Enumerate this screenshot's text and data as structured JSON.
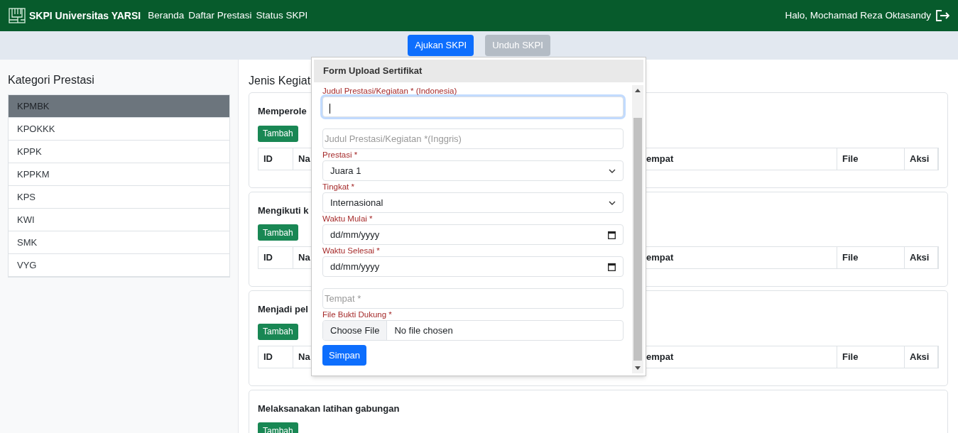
{
  "navbar": {
    "brand": "SKPI Universitas YARSI",
    "links": [
      "Beranda",
      "Daftar Prestasi",
      "Status SKPI"
    ],
    "greeting": "Halo, Mochamad Reza Oktasandy"
  },
  "actions": [
    {
      "label": "Ajukan SKPI",
      "disabled": false
    },
    {
      "label": "Unduh SKPI",
      "disabled": true
    }
  ],
  "sidebar": {
    "title": "Kategori Prestasi",
    "items": [
      {
        "label": "KPMBK",
        "selected": true
      },
      {
        "label": "KPOKKK",
        "selected": false
      },
      {
        "label": "KPPK",
        "selected": false
      },
      {
        "label": "KPPKM",
        "selected": false
      },
      {
        "label": "KPS",
        "selected": false
      },
      {
        "label": "KWI",
        "selected": false
      },
      {
        "label": "SMK",
        "selected": false
      },
      {
        "label": "VYG",
        "selected": false
      }
    ]
  },
  "main": {
    "title": "Jenis Kegiat",
    "cards": [
      {
        "title": "Memperole",
        "add_button": "Tambah",
        "columns": [
          "ID",
          "Na",
          "empat",
          "File",
          "Aksi"
        ]
      },
      {
        "title": "Mengikuti k",
        "add_button": "Tambah",
        "columns": [
          "ID",
          "Na",
          "empat",
          "File",
          "Aksi"
        ]
      },
      {
        "title": "Menjadi pel",
        "add_button": "Tambah",
        "columns": [
          "ID",
          "Na",
          "empat",
          "File",
          "Aksi"
        ]
      },
      {
        "title": "Melaksanakan latihan gabungan",
        "add_button": "Tambah"
      }
    ]
  },
  "modal": {
    "title": "Form Upload Sertifikat",
    "fields": [
      {
        "kind": "text",
        "label": "Judul Prestasi/Kegiatan * (Indonesia)",
        "focused": true
      },
      {
        "kind": "text",
        "placeholder": "Judul Prestasi/Kegiatan *(Inggris)",
        "focused": false
      },
      {
        "kind": "select",
        "label": "Prestasi *",
        "value": "Juara 1"
      },
      {
        "kind": "select",
        "label": "Tingkat *",
        "value": "Internasional"
      },
      {
        "kind": "date",
        "label": "Waktu Mulai *",
        "value": "dd/mm/yyyy"
      },
      {
        "kind": "date",
        "label": "Waktu Selesai *",
        "value": "dd/mm/yyyy"
      },
      {
        "kind": "text",
        "placeholder": "Tempat *",
        "focused": false
      },
      {
        "kind": "file",
        "label": "File Bukti Dukung *",
        "button": "Choose File",
        "value": "No file chosen"
      }
    ],
    "submit": "Simpan"
  }
}
